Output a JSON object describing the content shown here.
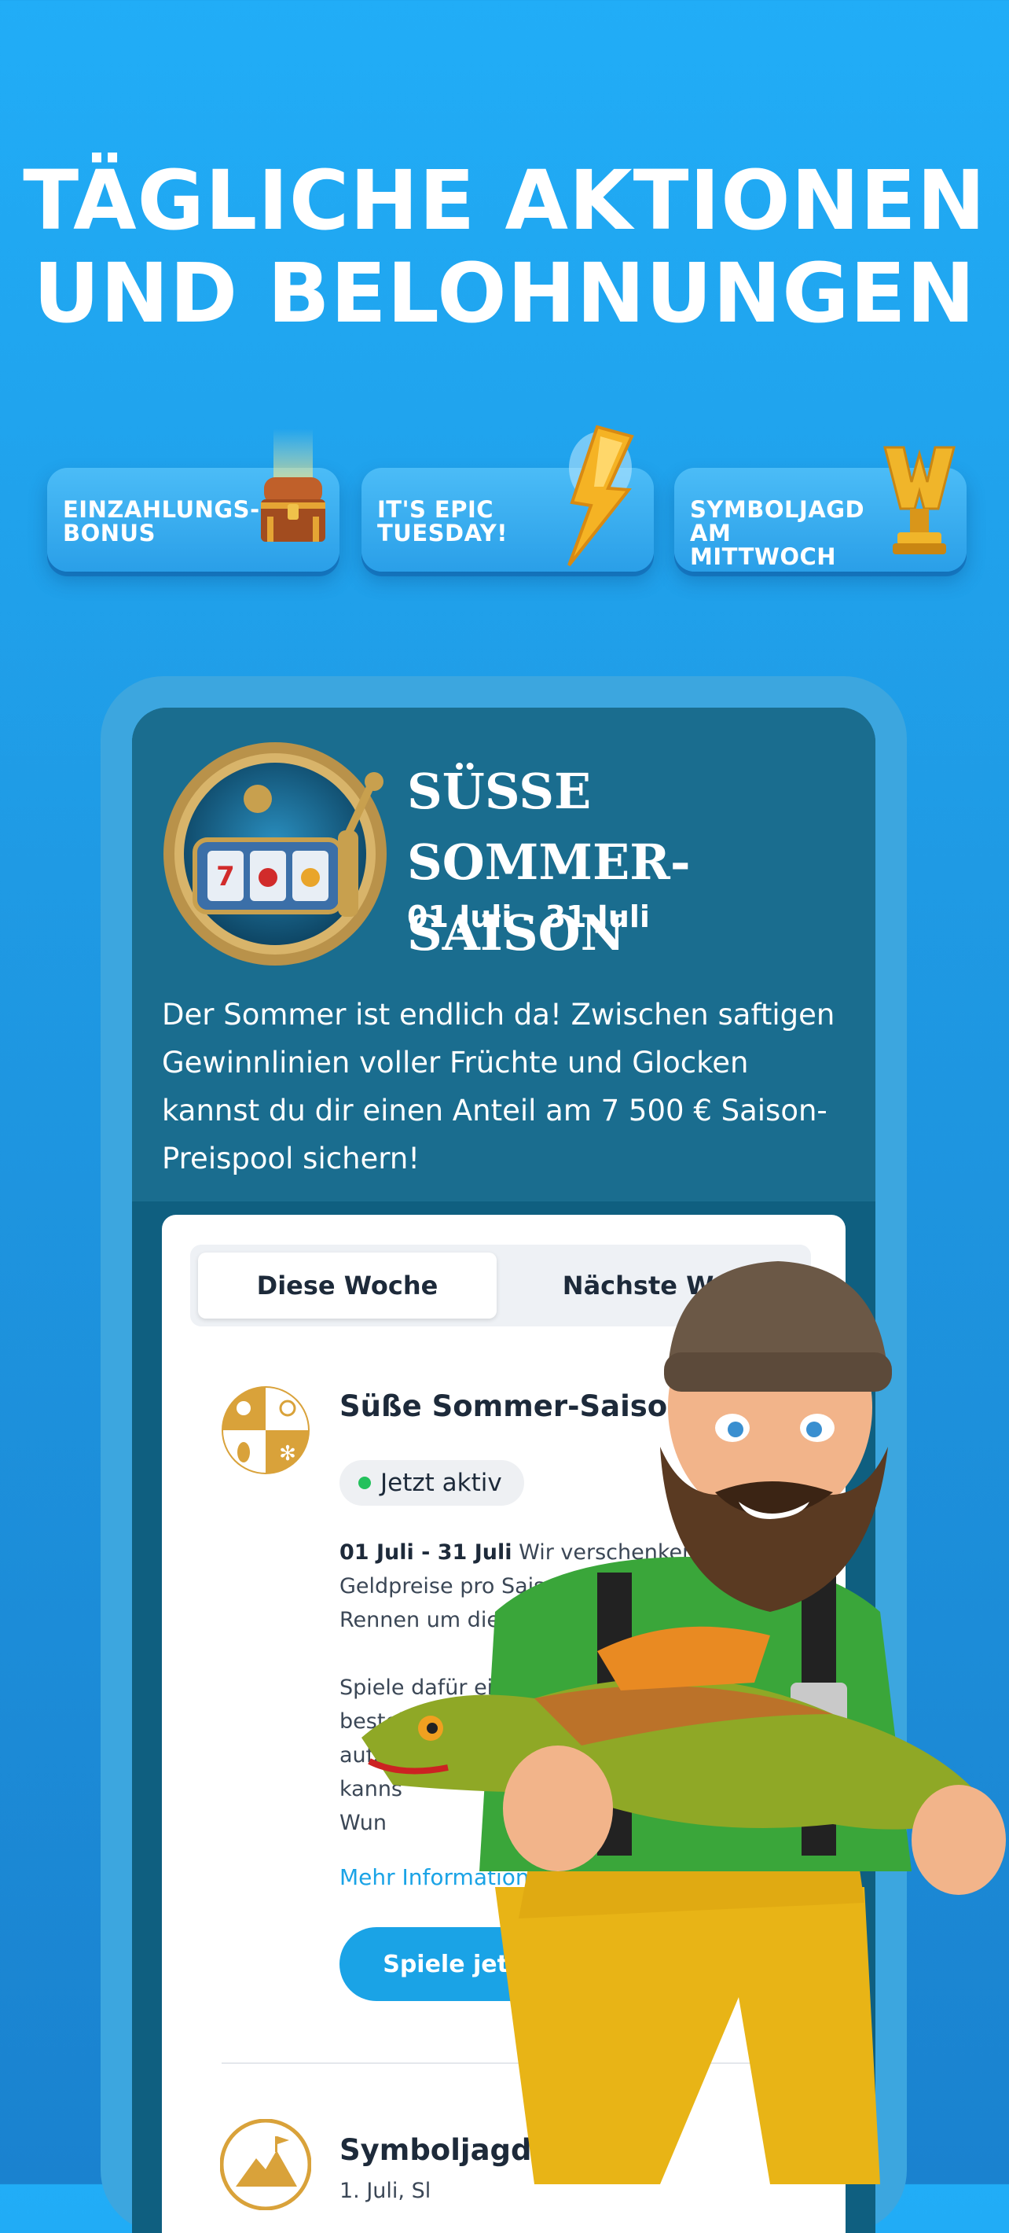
{
  "headline": {
    "line1": "TÄGLICHE AKTIONEN",
    "line2": "UND BELOHNUNGEN"
  },
  "promos": [
    {
      "line1": "EINZAHLUNGS-",
      "line2": "BONUS",
      "icon": "treasure-chest-icon"
    },
    {
      "line1": "IT'S EPIC",
      "line2": "TUESDAY!",
      "icon": "lightning-bolt-icon"
    },
    {
      "line1": "SYMBOLJAGD",
      "line2": "AM MITTWOCH",
      "icon": "w-trophy-icon"
    }
  ],
  "season": {
    "title_line1": "SÜSSE SOMMER-",
    "title_line2": "SAISON",
    "dates": "01 Juli - 31 Juli",
    "description": "Der Sommer ist endlich da! Zwischen saftigen Gewinnlinien voller Früchte und Glocken kannst du dir einen Anteil am 7 500 € Saison-Preispool sichern!",
    "badge_icon": "slot-machine-icon"
  },
  "tabs": {
    "this_week": "Diese Woche",
    "next_week": "Nächste Woc"
  },
  "item1": {
    "title": "Süße Sommer-Saison",
    "status": "Jetzt aktiv",
    "dates_bold": "01 Juli - 31 Juli",
    "body1_rest": " Wir verschenken 1",
    "body1_line2": "Geldpreise pro Saison. Nimm a",
    "body1_line3": "Rennen um die Geldpreis",
    "body2_line1": "Spiele dafür ein Slo",
    "body2_line2": "bestehe H",
    "body2_line3": "aufz",
    "body2_line4": "kanns",
    "body2_line5": "Wun",
    "more_link": "Mehr Informationen",
    "play_button": "Spiele jetzt",
    "icon": "seasons-icon"
  },
  "item2": {
    "title": "Symboljagd am M",
    "subtitle": "1. Juli, Sl",
    "icon": "mountain-icon"
  },
  "colors": {
    "background_top": "#21adf7",
    "accent_button": "#1aa3e6",
    "active_dot": "#23c15c",
    "screen_dark": "#0f5f80"
  }
}
